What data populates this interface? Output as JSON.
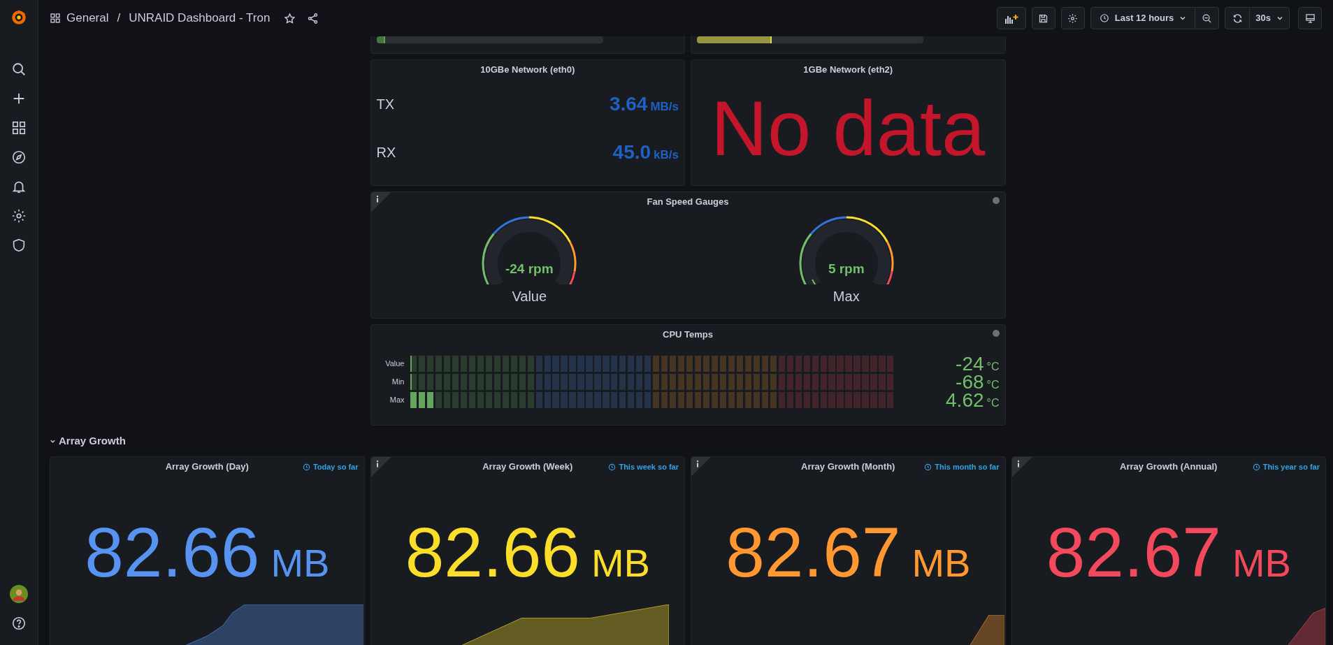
{
  "topbar": {
    "folder": "General",
    "separator": "/",
    "title": "UNRAID Dashboard - Tron",
    "starred": false,
    "time_range": "Last 12 hours",
    "refresh": "30s"
  },
  "top_bars": [
    {
      "level": 0.04,
      "color": "#56a64b"
    },
    {
      "level": 0.33,
      "color": "#e0d84a"
    }
  ],
  "network": {
    "title": "10GBe Network (eth0)",
    "rows": [
      {
        "label": "TX",
        "value": "3.64",
        "unit": "MB/s"
      },
      {
        "label": "RX",
        "value": "45.0",
        "unit": "kB/s"
      }
    ],
    "color": "#1f60c4"
  },
  "network2": {
    "title": "1GBe Network (eth2)",
    "message": "No data",
    "color": "#c4162a"
  },
  "fan_gauges": {
    "title": "Fan Speed Gauges",
    "info_corner": true,
    "gauges": [
      {
        "value": "-24 rpm",
        "label": "Value"
      },
      {
        "value": "5 rpm",
        "label": "Max",
        "level": 0.04
      }
    ]
  },
  "cpu_temps": {
    "title": "CPU Temps",
    "info_corner": false,
    "rows": [
      {
        "label": "Value",
        "level": 0,
        "value": "-24",
        "unit": "°C"
      },
      {
        "label": "Min",
        "level": 0,
        "value": "-68",
        "unit": "°C"
      },
      {
        "label": "Max",
        "level": 0.05,
        "value": "4.62",
        "unit": "°C"
      }
    ]
  },
  "section": {
    "title": "Array Growth",
    "expanded": true
  },
  "array_panels": [
    {
      "title": "Array Growth (Day)",
      "time_info": "Today so far",
      "value": "82.66",
      "unit": "MB",
      "color": "#5794f2",
      "info_corner": false
    },
    {
      "title": "Array Growth (Week)",
      "time_info": "This week so far",
      "value": "82.66",
      "unit": "MB",
      "color": "#fade2a",
      "info_corner": true
    },
    {
      "title": "Array Growth (Month)",
      "time_info": "This month so far",
      "value": "82.67",
      "unit": "MB",
      "color": "#ff9830",
      "info_corner": true
    },
    {
      "title": "Array Growth (Annual)",
      "time_info": "This year so far",
      "value": "82.67",
      "unit": "MB",
      "color": "#f2495c",
      "info_corner": true
    }
  ]
}
